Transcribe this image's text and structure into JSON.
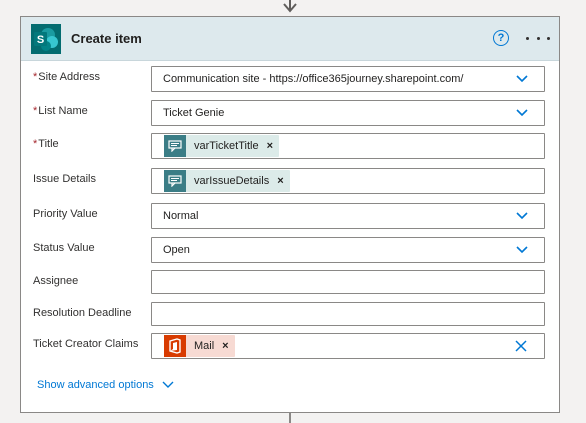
{
  "card": {
    "title": "Create item",
    "help_icon": "question-circle-icon",
    "more_icon": "ellipsis-icon",
    "app_icon": "sharepoint-logo",
    "sharepoint_letter": "S"
  },
  "fields": {
    "site_address": {
      "label": "Site Address",
      "value": "Communication site - https://office365journey.sharepoint.com/",
      "required": true
    },
    "list_name": {
      "label": "List Name",
      "value": "Ticket Genie",
      "required": true
    },
    "title": {
      "label": "Title",
      "token": "varTicketTitle",
      "required": true
    },
    "issue_details": {
      "label": "Issue Details",
      "token": "varIssueDetails"
    },
    "priority_value": {
      "label": "Priority Value",
      "value": "Normal"
    },
    "status_value": {
      "label": "Status Value",
      "value": "Open"
    },
    "assignee": {
      "label": "Assignee",
      "value": ""
    },
    "resolution_deadline": {
      "label": "Resolution Deadline",
      "value": ""
    },
    "ticket_creator_claims": {
      "label": "Ticket Creator Claims",
      "token": "Mail"
    }
  },
  "advanced_label": "Show advanced options",
  "required_marker": "*",
  "token_remove_symbol": "×",
  "colors": {
    "header_bg": "#dde9ed",
    "accent": "#0078d4",
    "variable_token": "#3b7d86",
    "office_token": "#d83b01",
    "required": "#a4262c"
  }
}
